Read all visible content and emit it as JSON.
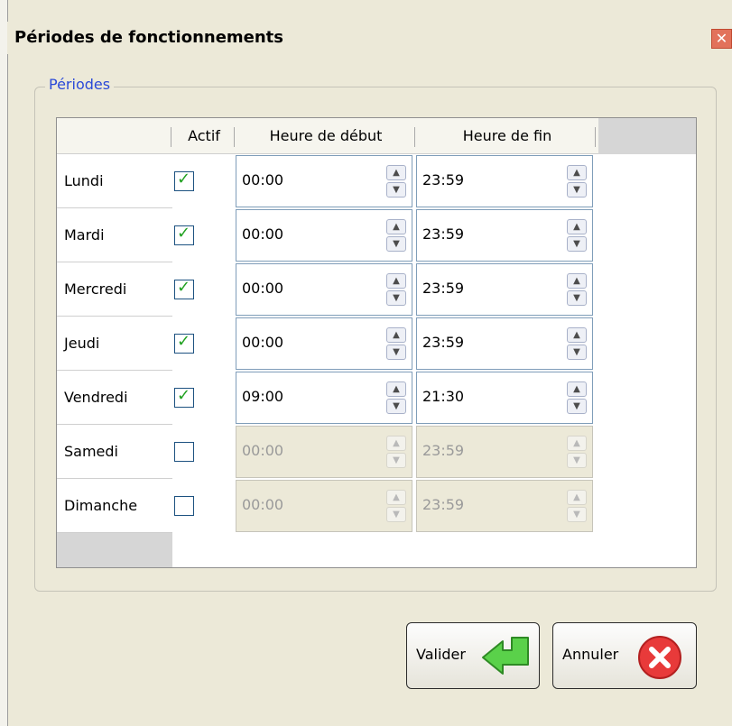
{
  "window": {
    "title": "Périodes de fonctionnements",
    "close_symbol": "✕"
  },
  "group": {
    "label": "Périodes"
  },
  "table": {
    "columns": [
      "Actif",
      "Heure de début",
      "Heure de fin"
    ],
    "rows": [
      {
        "day": "Lundi",
        "active": true,
        "start": "00:00",
        "end": "23:59"
      },
      {
        "day": "Mardi",
        "active": true,
        "start": "00:00",
        "end": "23:59"
      },
      {
        "day": "Mercredi",
        "active": true,
        "start": "00:00",
        "end": "23:59"
      },
      {
        "day": "Jeudi",
        "active": true,
        "start": "00:00",
        "end": "23:59"
      },
      {
        "day": "Vendredi",
        "active": true,
        "start": "09:00",
        "end": "21:30"
      },
      {
        "day": "Samedi",
        "active": false,
        "start": "00:00",
        "end": "23:59"
      },
      {
        "day": "Dimanche",
        "active": false,
        "start": "00:00",
        "end": "23:59"
      }
    ]
  },
  "buttons": {
    "ok_label": "Valider",
    "cancel_label": "Annuler"
  },
  "icons": {
    "ok": "green-arrow-icon",
    "cancel": "red-x-icon",
    "close": "close-icon"
  },
  "colors": {
    "checkmark": "#21a121",
    "group_label": "#2a49d8",
    "close": "#e2725b"
  }
}
